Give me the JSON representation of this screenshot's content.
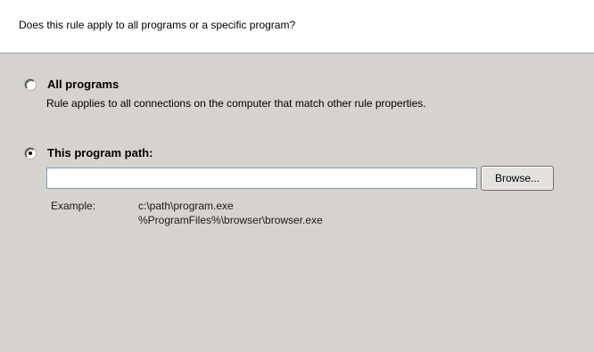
{
  "header": {
    "question": "Does this rule apply to all programs or a specific program?"
  },
  "options": {
    "all_programs": {
      "label": "All programs",
      "description": "Rule applies to all connections on the computer that match other rule properties.",
      "selected": false
    },
    "program_path": {
      "label": "This program path:",
      "selected": true,
      "value": "",
      "placeholder": ""
    }
  },
  "browse_button": {
    "label": "Browse..."
  },
  "example": {
    "label": "Example:",
    "lines": [
      "c:\\path\\program.exe",
      "%ProgramFiles%\\browser\\browser.exe"
    ]
  }
}
